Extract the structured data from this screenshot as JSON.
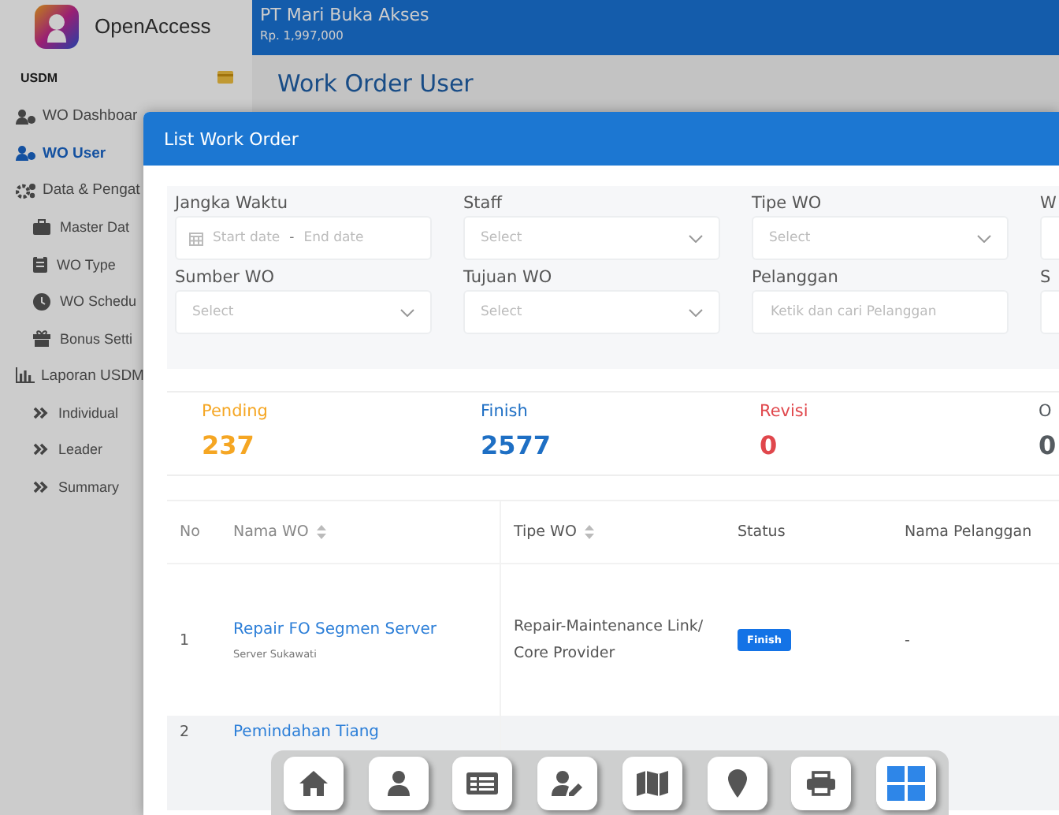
{
  "app": {
    "name": "OpenAccess"
  },
  "header": {
    "company": "PT Mari Buka Akses",
    "balance": "Rp. 1,997,000"
  },
  "page_title": "Work Order User",
  "sidebar": {
    "section": "USDM",
    "items": [
      {
        "label": "WO Dashboar",
        "selected": false
      },
      {
        "label": "WO User",
        "selected": true
      },
      {
        "label": "Data & Pengat",
        "selected": false,
        "children": [
          {
            "label": "Master Dat"
          },
          {
            "label": "WO Type"
          },
          {
            "label": "WO Schedu"
          },
          {
            "label": "Bonus Setti"
          }
        ]
      },
      {
        "label": "Laporan USDM",
        "selected": false,
        "children": [
          {
            "label": "Individual"
          },
          {
            "label": "Leader"
          },
          {
            "label": "Summary"
          }
        ]
      }
    ]
  },
  "modal": {
    "title": "List Work Order",
    "filters": [
      {
        "label": "Jangka Waktu",
        "kind": "daterange",
        "start_placeholder": "Start date",
        "separator": "-",
        "end_placeholder": "End date"
      },
      {
        "label": "Staff",
        "kind": "select",
        "placeholder": "Select"
      },
      {
        "label": "Tipe WO",
        "kind": "select",
        "placeholder": "Select"
      },
      {
        "label": "W",
        "kind": "select"
      },
      {
        "label": "Sumber WO",
        "kind": "select",
        "placeholder": "Select"
      },
      {
        "label": "Tujuan WO",
        "kind": "select",
        "placeholder": "Select"
      },
      {
        "label": "Pelanggan",
        "kind": "text",
        "placeholder": "Ketik dan cari Pelanggan"
      },
      {
        "label": "S",
        "kind": "select"
      }
    ],
    "stats": [
      {
        "label": "Pending",
        "value": "237",
        "color": "#f5a623"
      },
      {
        "label": "Finish",
        "value": "2577",
        "color": "#1e6fc4"
      },
      {
        "label": "Revisi",
        "value": "0",
        "color": "#e0474c"
      },
      {
        "label": "O",
        "value": "0",
        "color": "#555b60"
      }
    ],
    "table": {
      "columns": [
        {
          "label": "No",
          "sortable": false
        },
        {
          "label": "Nama WO",
          "sortable": true
        },
        {
          "label": "Tipe WO",
          "sortable": true
        },
        {
          "label": "Status",
          "sortable": false
        },
        {
          "label": "Nama Pelanggan",
          "sortable": false
        }
      ],
      "rows": [
        {
          "no": "1",
          "name": "Repair FO Segmen Server",
          "subtitle": "Server Sukawati",
          "type": "Repair-Maintenance Link/ Core Provider",
          "status": "Finish",
          "customer": "-"
        },
        {
          "no": "2",
          "name": "Pemindahan Tiang"
        }
      ]
    }
  },
  "dock": [
    {
      "selected": false
    },
    {
      "selected": false
    },
    {
      "selected": false
    },
    {
      "selected": false
    },
    {
      "selected": false
    },
    {
      "selected": false
    },
    {
      "selected": false
    },
    {
      "selected": true
    }
  ]
}
